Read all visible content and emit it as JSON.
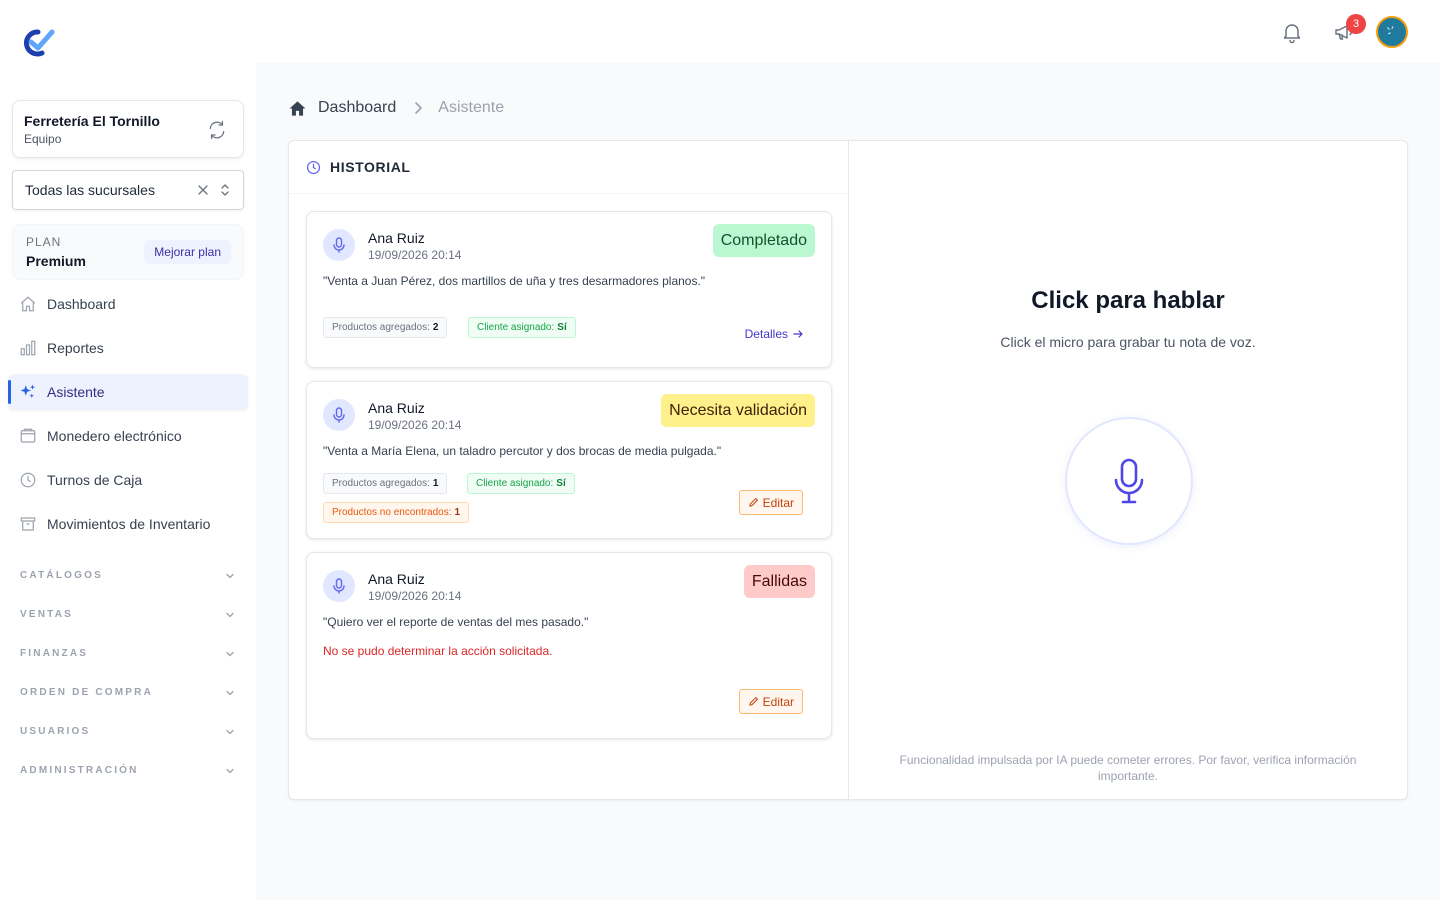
{
  "sidebar": {
    "org": {
      "name": "Ferretería El Tornillo",
      "role": "Equipo"
    },
    "branch_select": {
      "value": "Todas las sucursales"
    },
    "plan": {
      "label": "PLAN",
      "name": "Premium",
      "upgrade_label": "Mejorar plan"
    },
    "nav": [
      {
        "label": "Dashboard",
        "icon": "home-icon"
      },
      {
        "label": "Reportes",
        "icon": "bar-chart-icon"
      },
      {
        "label": "Asistente",
        "icon": "sparkles-icon",
        "active": true
      },
      {
        "label": "Monedero electrónico",
        "icon": "wallet-icon"
      },
      {
        "label": "Turnos de Caja",
        "icon": "clock-icon"
      },
      {
        "label": "Movimientos de Inventario",
        "icon": "archive-box-icon"
      }
    ],
    "groups": [
      "CATÁLOGOS",
      "VENTAS",
      "FINANZAS",
      "ORDEN DE COMPRA",
      "USUARIOS",
      "ADMINISTRACIÓN"
    ]
  },
  "topbar": {
    "notifications_icon": "bell-icon",
    "announcements_icon": "megaphone-icon",
    "announcements_count": "3"
  },
  "breadcrumb": {
    "home": "Dashboard",
    "current": "Asistente"
  },
  "history": {
    "title": "HISTORIAL",
    "cards": [
      {
        "user": "Ana Ruiz",
        "date": "19/09/2026 20:14",
        "status": "Completado",
        "quote": "\"Venta a Juan Pérez, dos martillos de uña y tres desarmadores planos.\"",
        "tags": [
          {
            "label": "Productos agregados:",
            "value": "2"
          },
          {
            "label": "Cliente asignado:",
            "value": "Sí"
          }
        ],
        "action": "Detalles"
      },
      {
        "user": "Ana Ruiz",
        "date": "19/09/2026 20:14",
        "status": "Necesita validación",
        "quote": "\"Venta a María Elena, un taladro percutor y dos brocas de media pulgada.\"",
        "tags": [
          {
            "label": "Productos agregados:",
            "value": "1"
          },
          {
            "label": "Cliente asignado:",
            "value": "Sí"
          },
          {
            "label": "Productos no encontrados:",
            "value": "1"
          }
        ],
        "action": "Editar"
      },
      {
        "user": "Ana Ruiz",
        "date": "19/09/2026 20:14",
        "status": "Fallidas",
        "quote": "\"Quiero ver el reporte de ventas del mes pasado.\"",
        "error": "No se pudo determinar la acción solicitada.",
        "action": "Editar"
      }
    ]
  },
  "voice": {
    "title": "Click para hablar",
    "subtitle": "Click el micro para grabar tu nota de voz.",
    "disclaimer": "Funcionalidad impulsada por IA puede cometer errores. Por favor, verifica información importante."
  },
  "colors": {
    "accent": "#4f46e5",
    "active_bar": "#2563eb",
    "badge": "#ef4444"
  }
}
